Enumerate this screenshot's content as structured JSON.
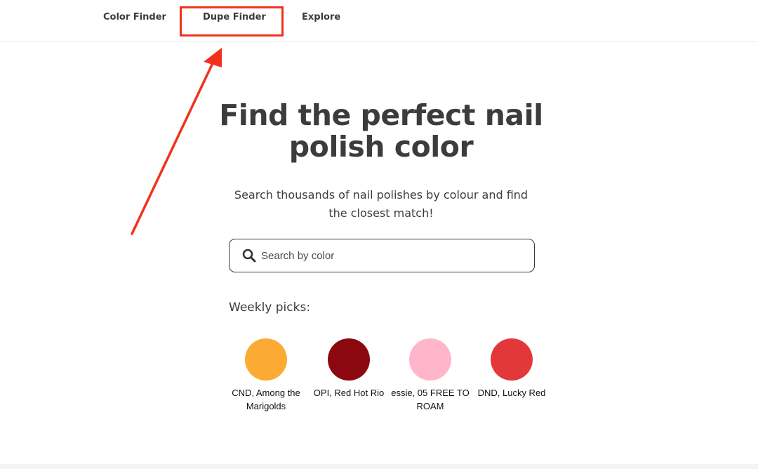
{
  "nav": {
    "items": [
      {
        "label": "Color Finder"
      },
      {
        "label": "Dupe Finder"
      },
      {
        "label": "Explore"
      }
    ]
  },
  "annotation": {
    "highlight_color": "#f0321c"
  },
  "hero": {
    "title": "Find the perfect nail polish color",
    "subtitle": "Search thousands of nail polishes by colour and find the closest match!"
  },
  "search": {
    "placeholder": "Search by color",
    "value": "",
    "icon": "search-icon"
  },
  "weekly": {
    "label": "Weekly picks:",
    "picks": [
      {
        "name": "CND, Among the Marigolds",
        "color": "#fbaa33"
      },
      {
        "name": "OPI, Red Hot Rio",
        "color": "#8c0810"
      },
      {
        "name": "essie, 05 FREE TO ROAM",
        "color": "#ffb6cb"
      },
      {
        "name": "DND, Lucky Red",
        "color": "#e3383a"
      }
    ]
  }
}
